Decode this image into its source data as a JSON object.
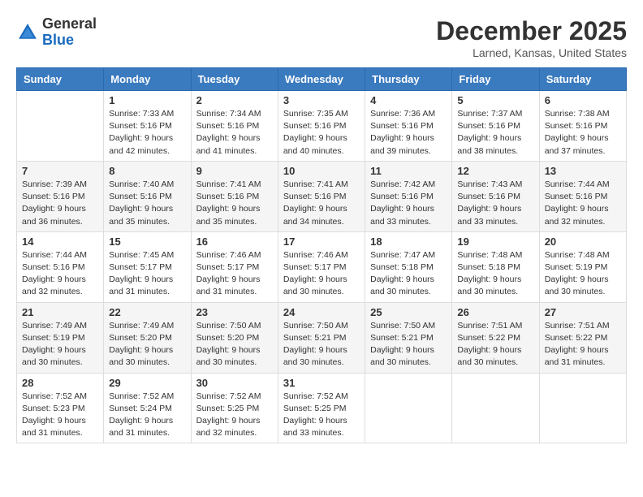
{
  "header": {
    "logo_general": "General",
    "logo_blue": "Blue",
    "month_title": "December 2025",
    "location": "Larned, Kansas, United States"
  },
  "days_of_week": [
    "Sunday",
    "Monday",
    "Tuesday",
    "Wednesday",
    "Thursday",
    "Friday",
    "Saturday"
  ],
  "weeks": [
    [
      {
        "day": "",
        "sunrise": "",
        "sunset": "",
        "daylight": ""
      },
      {
        "day": "1",
        "sunrise": "Sunrise: 7:33 AM",
        "sunset": "Sunset: 5:16 PM",
        "daylight": "Daylight: 9 hours and 42 minutes."
      },
      {
        "day": "2",
        "sunrise": "Sunrise: 7:34 AM",
        "sunset": "Sunset: 5:16 PM",
        "daylight": "Daylight: 9 hours and 41 minutes."
      },
      {
        "day": "3",
        "sunrise": "Sunrise: 7:35 AM",
        "sunset": "Sunset: 5:16 PM",
        "daylight": "Daylight: 9 hours and 40 minutes."
      },
      {
        "day": "4",
        "sunrise": "Sunrise: 7:36 AM",
        "sunset": "Sunset: 5:16 PM",
        "daylight": "Daylight: 9 hours and 39 minutes."
      },
      {
        "day": "5",
        "sunrise": "Sunrise: 7:37 AM",
        "sunset": "Sunset: 5:16 PM",
        "daylight": "Daylight: 9 hours and 38 minutes."
      },
      {
        "day": "6",
        "sunrise": "Sunrise: 7:38 AM",
        "sunset": "Sunset: 5:16 PM",
        "daylight": "Daylight: 9 hours and 37 minutes."
      }
    ],
    [
      {
        "day": "7",
        "sunrise": "Sunrise: 7:39 AM",
        "sunset": "Sunset: 5:16 PM",
        "daylight": "Daylight: 9 hours and 36 minutes."
      },
      {
        "day": "8",
        "sunrise": "Sunrise: 7:40 AM",
        "sunset": "Sunset: 5:16 PM",
        "daylight": "Daylight: 9 hours and 35 minutes."
      },
      {
        "day": "9",
        "sunrise": "Sunrise: 7:41 AM",
        "sunset": "Sunset: 5:16 PM",
        "daylight": "Daylight: 9 hours and 35 minutes."
      },
      {
        "day": "10",
        "sunrise": "Sunrise: 7:41 AM",
        "sunset": "Sunset: 5:16 PM",
        "daylight": "Daylight: 9 hours and 34 minutes."
      },
      {
        "day": "11",
        "sunrise": "Sunrise: 7:42 AM",
        "sunset": "Sunset: 5:16 PM",
        "daylight": "Daylight: 9 hours and 33 minutes."
      },
      {
        "day": "12",
        "sunrise": "Sunrise: 7:43 AM",
        "sunset": "Sunset: 5:16 PM",
        "daylight": "Daylight: 9 hours and 33 minutes."
      },
      {
        "day": "13",
        "sunrise": "Sunrise: 7:44 AM",
        "sunset": "Sunset: 5:16 PM",
        "daylight": "Daylight: 9 hours and 32 minutes."
      }
    ],
    [
      {
        "day": "14",
        "sunrise": "Sunrise: 7:44 AM",
        "sunset": "Sunset: 5:16 PM",
        "daylight": "Daylight: 9 hours and 32 minutes."
      },
      {
        "day": "15",
        "sunrise": "Sunrise: 7:45 AM",
        "sunset": "Sunset: 5:17 PM",
        "daylight": "Daylight: 9 hours and 31 minutes."
      },
      {
        "day": "16",
        "sunrise": "Sunrise: 7:46 AM",
        "sunset": "Sunset: 5:17 PM",
        "daylight": "Daylight: 9 hours and 31 minutes."
      },
      {
        "day": "17",
        "sunrise": "Sunrise: 7:46 AM",
        "sunset": "Sunset: 5:17 PM",
        "daylight": "Daylight: 9 hours and 30 minutes."
      },
      {
        "day": "18",
        "sunrise": "Sunrise: 7:47 AM",
        "sunset": "Sunset: 5:18 PM",
        "daylight": "Daylight: 9 hours and 30 minutes."
      },
      {
        "day": "19",
        "sunrise": "Sunrise: 7:48 AM",
        "sunset": "Sunset: 5:18 PM",
        "daylight": "Daylight: 9 hours and 30 minutes."
      },
      {
        "day": "20",
        "sunrise": "Sunrise: 7:48 AM",
        "sunset": "Sunset: 5:19 PM",
        "daylight": "Daylight: 9 hours and 30 minutes."
      }
    ],
    [
      {
        "day": "21",
        "sunrise": "Sunrise: 7:49 AM",
        "sunset": "Sunset: 5:19 PM",
        "daylight": "Daylight: 9 hours and 30 minutes."
      },
      {
        "day": "22",
        "sunrise": "Sunrise: 7:49 AM",
        "sunset": "Sunset: 5:20 PM",
        "daylight": "Daylight: 9 hours and 30 minutes."
      },
      {
        "day": "23",
        "sunrise": "Sunrise: 7:50 AM",
        "sunset": "Sunset: 5:20 PM",
        "daylight": "Daylight: 9 hours and 30 minutes."
      },
      {
        "day": "24",
        "sunrise": "Sunrise: 7:50 AM",
        "sunset": "Sunset: 5:21 PM",
        "daylight": "Daylight: 9 hours and 30 minutes."
      },
      {
        "day": "25",
        "sunrise": "Sunrise: 7:50 AM",
        "sunset": "Sunset: 5:21 PM",
        "daylight": "Daylight: 9 hours and 30 minutes."
      },
      {
        "day": "26",
        "sunrise": "Sunrise: 7:51 AM",
        "sunset": "Sunset: 5:22 PM",
        "daylight": "Daylight: 9 hours and 30 minutes."
      },
      {
        "day": "27",
        "sunrise": "Sunrise: 7:51 AM",
        "sunset": "Sunset: 5:22 PM",
        "daylight": "Daylight: 9 hours and 31 minutes."
      }
    ],
    [
      {
        "day": "28",
        "sunrise": "Sunrise: 7:52 AM",
        "sunset": "Sunset: 5:23 PM",
        "daylight": "Daylight: 9 hours and 31 minutes."
      },
      {
        "day": "29",
        "sunrise": "Sunrise: 7:52 AM",
        "sunset": "Sunset: 5:24 PM",
        "daylight": "Daylight: 9 hours and 31 minutes."
      },
      {
        "day": "30",
        "sunrise": "Sunrise: 7:52 AM",
        "sunset": "Sunset: 5:25 PM",
        "daylight": "Daylight: 9 hours and 32 minutes."
      },
      {
        "day": "31",
        "sunrise": "Sunrise: 7:52 AM",
        "sunset": "Sunset: 5:25 PM",
        "daylight": "Daylight: 9 hours and 33 minutes."
      },
      {
        "day": "",
        "sunrise": "",
        "sunset": "",
        "daylight": ""
      },
      {
        "day": "",
        "sunrise": "",
        "sunset": "",
        "daylight": ""
      },
      {
        "day": "",
        "sunrise": "",
        "sunset": "",
        "daylight": ""
      }
    ]
  ]
}
